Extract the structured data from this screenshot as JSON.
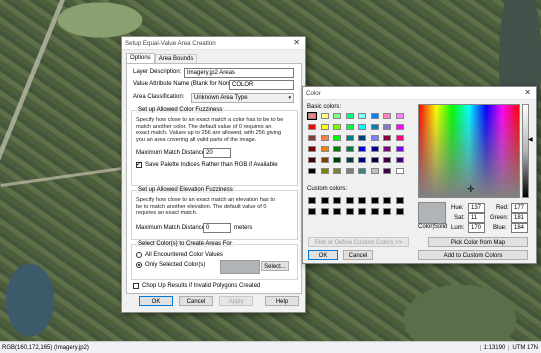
{
  "status_bar": {
    "left": "RGB(160,172,165) (Imagery.jp2)",
    "scale": "1:13190",
    "utm": "UTM 17N"
  },
  "equal_area_dialog": {
    "title": "Setup Equal-Value Area Creation",
    "tabs": [
      "Options",
      "Area Bounds"
    ],
    "layer_description_label": "Layer Description:",
    "layer_description_value": "Imagery.jp2 Areas",
    "value_attr_label": "Value Attribute Name (Blank for None):",
    "value_attr_value": "COLOR",
    "area_class_label": "Area Classification:",
    "area_class_value": "Unknown Area Type",
    "color_fuzz_title": "Set up Allowed Color Fuzziness",
    "color_fuzz_desc": [
      "Specify how close to an exact match a color has to be to be",
      "match another color. The default value of 0 requires an",
      "exact match. Values up to 256 are allowed, with 256 giving",
      "you an area covering all valid parts of the image."
    ],
    "max_match_label": "Maximum Match Distance:",
    "max_match_value": "20",
    "palette_check_label": "Save Palette Indices Rather than RGB if Available",
    "palette_checked": true,
    "elev_fuzz_title": "Set up Allowed Elevation Fuzziness",
    "elev_fuzz_desc": [
      "Specify how close to an exact match an elevation has to",
      "be to match another elevation. The default value of 0",
      "requires an exact match."
    ],
    "elev_max_label": "Maximum Match Distance:",
    "elev_max_value": "0",
    "elev_units": "meters",
    "select_colors_title": "Select Color(s) to Create Areas For",
    "all_colors_label": "All Encountered Color Values",
    "only_selected_label": "Only Selected Color(s)",
    "select_button": "Select...",
    "chop_label": "Chop Up Results if Invalid Polygons Created",
    "chop_checked": false,
    "ok": "OK",
    "cancel": "Cancel",
    "apply": "Apply",
    "help": "Help"
  },
  "color_dialog": {
    "title": "Color",
    "basic_colors_label": "Basic colors:",
    "custom_colors_label": "Custom colors:",
    "define_custom_button": "Pick or Define Custom Colors >>",
    "ok": "OK",
    "cancel": "Cancel",
    "color_solid_label": "Color|Solid",
    "hue_label": "Hue:",
    "hue": "137",
    "sat_label": "Sat:",
    "sat": "11",
    "lum_label": "Lum:",
    "lum": "170",
    "red_label": "Red:",
    "red": "177",
    "green_label": "Green:",
    "green": "181",
    "blue_label": "Blue:",
    "blue": "184",
    "pick_screen_button": "Pick Color from Map",
    "add_custom_button": "Add to Custom Colors",
    "preview_color": "#b1b5b8",
    "basic_colors": [
      "#ff8080",
      "#ffff80",
      "#80ff80",
      "#00ff80",
      "#80ffff",
      "#0080ff",
      "#ff80c0",
      "#ff80ff",
      "#ff0000",
      "#ffff00",
      "#80ff00",
      "#00ff40",
      "#00ffff",
      "#0080c0",
      "#8080c0",
      "#ff00ff",
      "#804040",
      "#ff8040",
      "#00ff00",
      "#008080",
      "#004080",
      "#8080ff",
      "#800040",
      "#ff0080",
      "#800000",
      "#ff8000",
      "#008000",
      "#008040",
      "#0000ff",
      "#0000a0",
      "#800080",
      "#8000ff",
      "#400000",
      "#804000",
      "#004000",
      "#004040",
      "#000080",
      "#000040",
      "#400040",
      "#400080",
      "#000000",
      "#808000",
      "#808040",
      "#808080",
      "#408080",
      "#c0c0c0",
      "#400040",
      "#ffffff"
    ]
  }
}
